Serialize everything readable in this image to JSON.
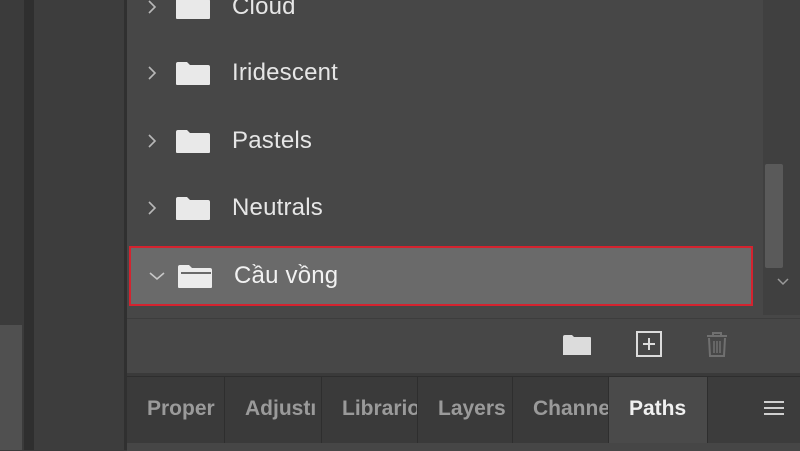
{
  "presets": {
    "items": [
      {
        "label": "Cloud",
        "expanded": false
      },
      {
        "label": "Iridescent",
        "expanded": false
      },
      {
        "label": "Pastels",
        "expanded": false
      },
      {
        "label": "Neutrals",
        "expanded": false
      },
      {
        "label": "Cầu vồng",
        "expanded": true,
        "selected": true
      }
    ]
  },
  "footer": {
    "buttons": [
      "new-group-folder-icon",
      "new-preset-icon",
      "delete-trash-icon"
    ]
  },
  "tabs": {
    "items": [
      {
        "label": "Proper",
        "active": false
      },
      {
        "label": "Adjustı",
        "active": false
      },
      {
        "label": "Librario",
        "active": false
      },
      {
        "label": "Layers",
        "active": false
      },
      {
        "label": "Channe",
        "active": false
      },
      {
        "label": "Paths",
        "active": true
      }
    ],
    "menu_icon": "hamburger-menu-icon"
  },
  "colors": {
    "selection_border": "#d4232f",
    "selected_row": "#6a6a6a",
    "panel_bg": "#474747"
  }
}
